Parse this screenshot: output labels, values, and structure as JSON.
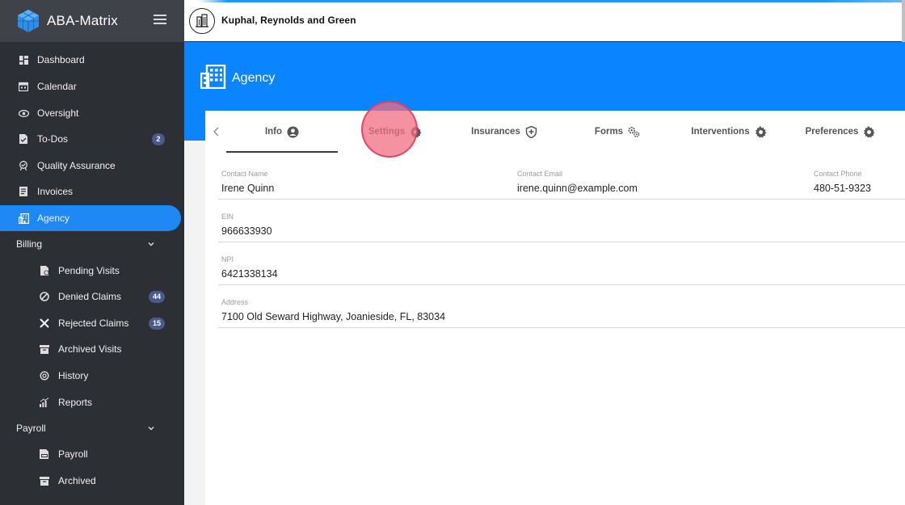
{
  "app": {
    "name": "ABA-Matrix"
  },
  "org": {
    "name": "Kuphal, Reynolds and Green"
  },
  "sidebar": {
    "items": [
      {
        "label": "Dashboard",
        "icon": "dashboard-icon"
      },
      {
        "label": "Calendar",
        "icon": "calendar-icon"
      },
      {
        "label": "Oversight",
        "icon": "eye-icon"
      },
      {
        "label": "To-Dos",
        "icon": "todo-icon",
        "badge": "2"
      },
      {
        "label": "Quality Assurance",
        "icon": "quality-icon"
      },
      {
        "label": "Invoices",
        "icon": "invoice-icon"
      },
      {
        "label": "Agency",
        "icon": "building-icon",
        "active": true
      }
    ],
    "billing": {
      "label": "Billing",
      "items": [
        {
          "label": "Pending Visits",
          "icon": "pending-icon"
        },
        {
          "label": "Denied Claims",
          "icon": "denied-icon",
          "badge": "44"
        },
        {
          "label": "Rejected Claims",
          "icon": "close-icon",
          "badge": "15"
        },
        {
          "label": "Archived Visits",
          "icon": "archive-icon"
        },
        {
          "label": "History",
          "icon": "history-icon"
        },
        {
          "label": "Reports",
          "icon": "reports-icon"
        }
      ]
    },
    "payroll": {
      "label": "Payroll",
      "items": [
        {
          "label": "Payroll",
          "icon": "payroll-icon"
        },
        {
          "label": "Archived",
          "icon": "archive-icon"
        }
      ]
    }
  },
  "page": {
    "title": "Agency"
  },
  "tabs": [
    {
      "label": "Info",
      "icon": "user-circle-icon",
      "active": true
    },
    {
      "label": "Settings",
      "icon": "gear-icon"
    },
    {
      "label": "Insurances",
      "icon": "shield-icon"
    },
    {
      "label": "Forms",
      "icon": "gears-icon"
    },
    {
      "label": "Interventions",
      "icon": "gear-icon"
    },
    {
      "label": "Preferences",
      "icon": "gear-icon"
    }
  ],
  "info": {
    "contact_name_label": "Contact Name",
    "contact_name": "Irene Quinn",
    "contact_email_label": "Contact Email",
    "contact_email": "irene.quinn@example.com",
    "contact_phone_label": "Contact Phone",
    "contact_phone": "480-51-9323",
    "ein_label": "EIN",
    "ein": "966633930",
    "npi_label": "NPI",
    "npi": "6421338134",
    "address_label": "Address",
    "address": "7100 Old Seward Highway, Joanieside, FL, 83034"
  },
  "colors": {
    "accent": "#1e88f5",
    "header": "#0a84ff",
    "sidebar": "#2c2f33",
    "badge": "#4a5a8c"
  }
}
